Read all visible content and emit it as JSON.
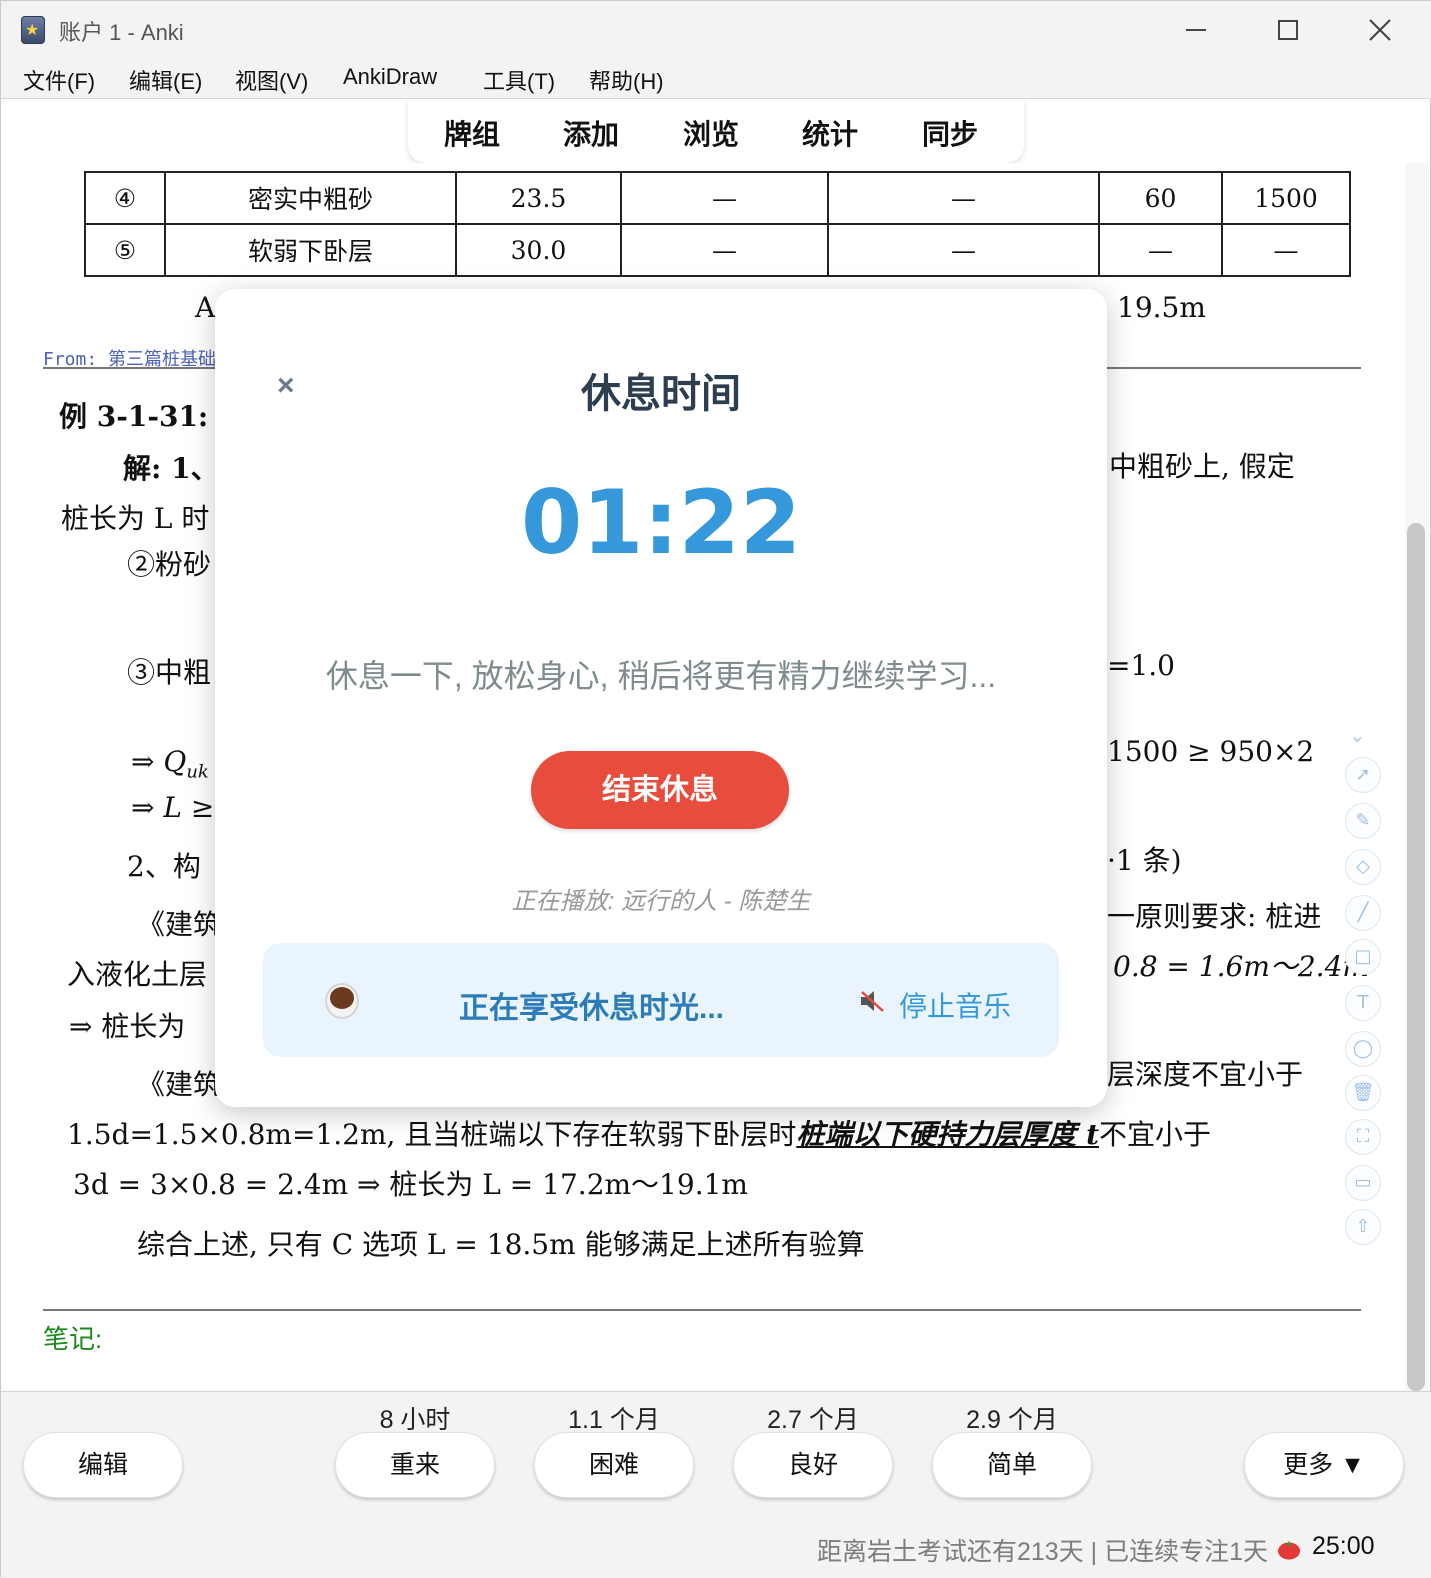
{
  "window": {
    "title": "账户 1 - Anki"
  },
  "menu": [
    "文件(F)",
    "编辑(E)",
    "视图(V)",
    "AnkiDraw",
    "工具(T)",
    "帮助(H)"
  ],
  "toolbar": [
    "牌组",
    "添加",
    "浏览",
    "统计",
    "同步"
  ],
  "card": {
    "table_rows": [
      [
        "④",
        "密实中粗砂",
        "23.5",
        "—",
        "—",
        "60",
        "1500"
      ],
      [
        "⑤",
        "软弱下卧层",
        "30.0",
        "—",
        "—",
        "—",
        "—"
      ]
    ],
    "line_answer_a": "A",
    "line_answer_d": "19.5m",
    "from": "From: 第三篇桩基础",
    "example_title": "例 3-1-31:",
    "solution_start": "解: 1、",
    "solution_right": "中粗砂上, 假定",
    "pile_length_start": "桩长为 L 时",
    "layer2": "②粉砂",
    "layer3": "③中粗",
    "eq_right_1": "=1.0",
    "q_uk": "⇒ Q",
    "q_uk_sub": "uk",
    "eq_right_2": "1500 ≥ 950×2",
    "l_geq": "⇒ L ≥",
    "section2": "2、构",
    "sec2_right": "·1 条)",
    "code_quote_1": "《建筑",
    "code_right_1": "一原则要求: 桩进",
    "liquefied": "入液化土层",
    "liquefied_right": "0.8 = 1.6m〜2.4m",
    "pile_length": "⇒ 桩长为",
    "code_quote_2": "《建筑",
    "code_right_2": "层深度不宜小于",
    "line_1d5": "1.5d=1.5×0.8m=1.2m, 且当桩端以下存在软弱下卧层时",
    "line_1d5_underlined": "桩端以下硬持力层厚度 t",
    "line_1d5_end": "不宜小于",
    "line_3d": "3d = 3×0.8 = 2.4m ⇒ 桩长为 L = 17.2m〜19.1m",
    "conclusion": "综合上述, 只有 C 选项 L = 18.5m 能够满足上述所有验算",
    "notes_label": "笔记:"
  },
  "draw_tools": [
    "select-icon",
    "pen-icon",
    "eraser-icon",
    "line-icon",
    "rectangle-icon",
    "text-icon",
    "lasso-icon",
    "trash-icon",
    "fullscreen-icon",
    "window-icon",
    "collapse-icon"
  ],
  "break_modal": {
    "close": "×",
    "title": "休息时间",
    "timer": "01:22",
    "message": "休息一下, 放松身心, 稍后将更有精力继续学习...",
    "end_button": "结束休息",
    "now_playing": "正在播放: 远行的人 - 陈楚生",
    "enjoy_text": "正在享受休息时光...",
    "stop_music": "停止音乐",
    "colors": {
      "title": "#2c3e50",
      "timer": "#3498db",
      "end_button": "#e74c3c",
      "panel": "#eaf4fd"
    }
  },
  "answer_bar": {
    "edit": "编辑",
    "buttons": [
      {
        "label": "重来",
        "interval": "8 小时"
      },
      {
        "label": "困难",
        "interval": "1.1 个月"
      },
      {
        "label": "良好",
        "interval": "2.7 个月"
      },
      {
        "label": "简单",
        "interval": "2.9 个月"
      }
    ],
    "more": "更多 ▼"
  },
  "status": {
    "text": "距离岩土考试还有213天 | 已连续专注1天",
    "pomodoro_time": "25:00"
  }
}
